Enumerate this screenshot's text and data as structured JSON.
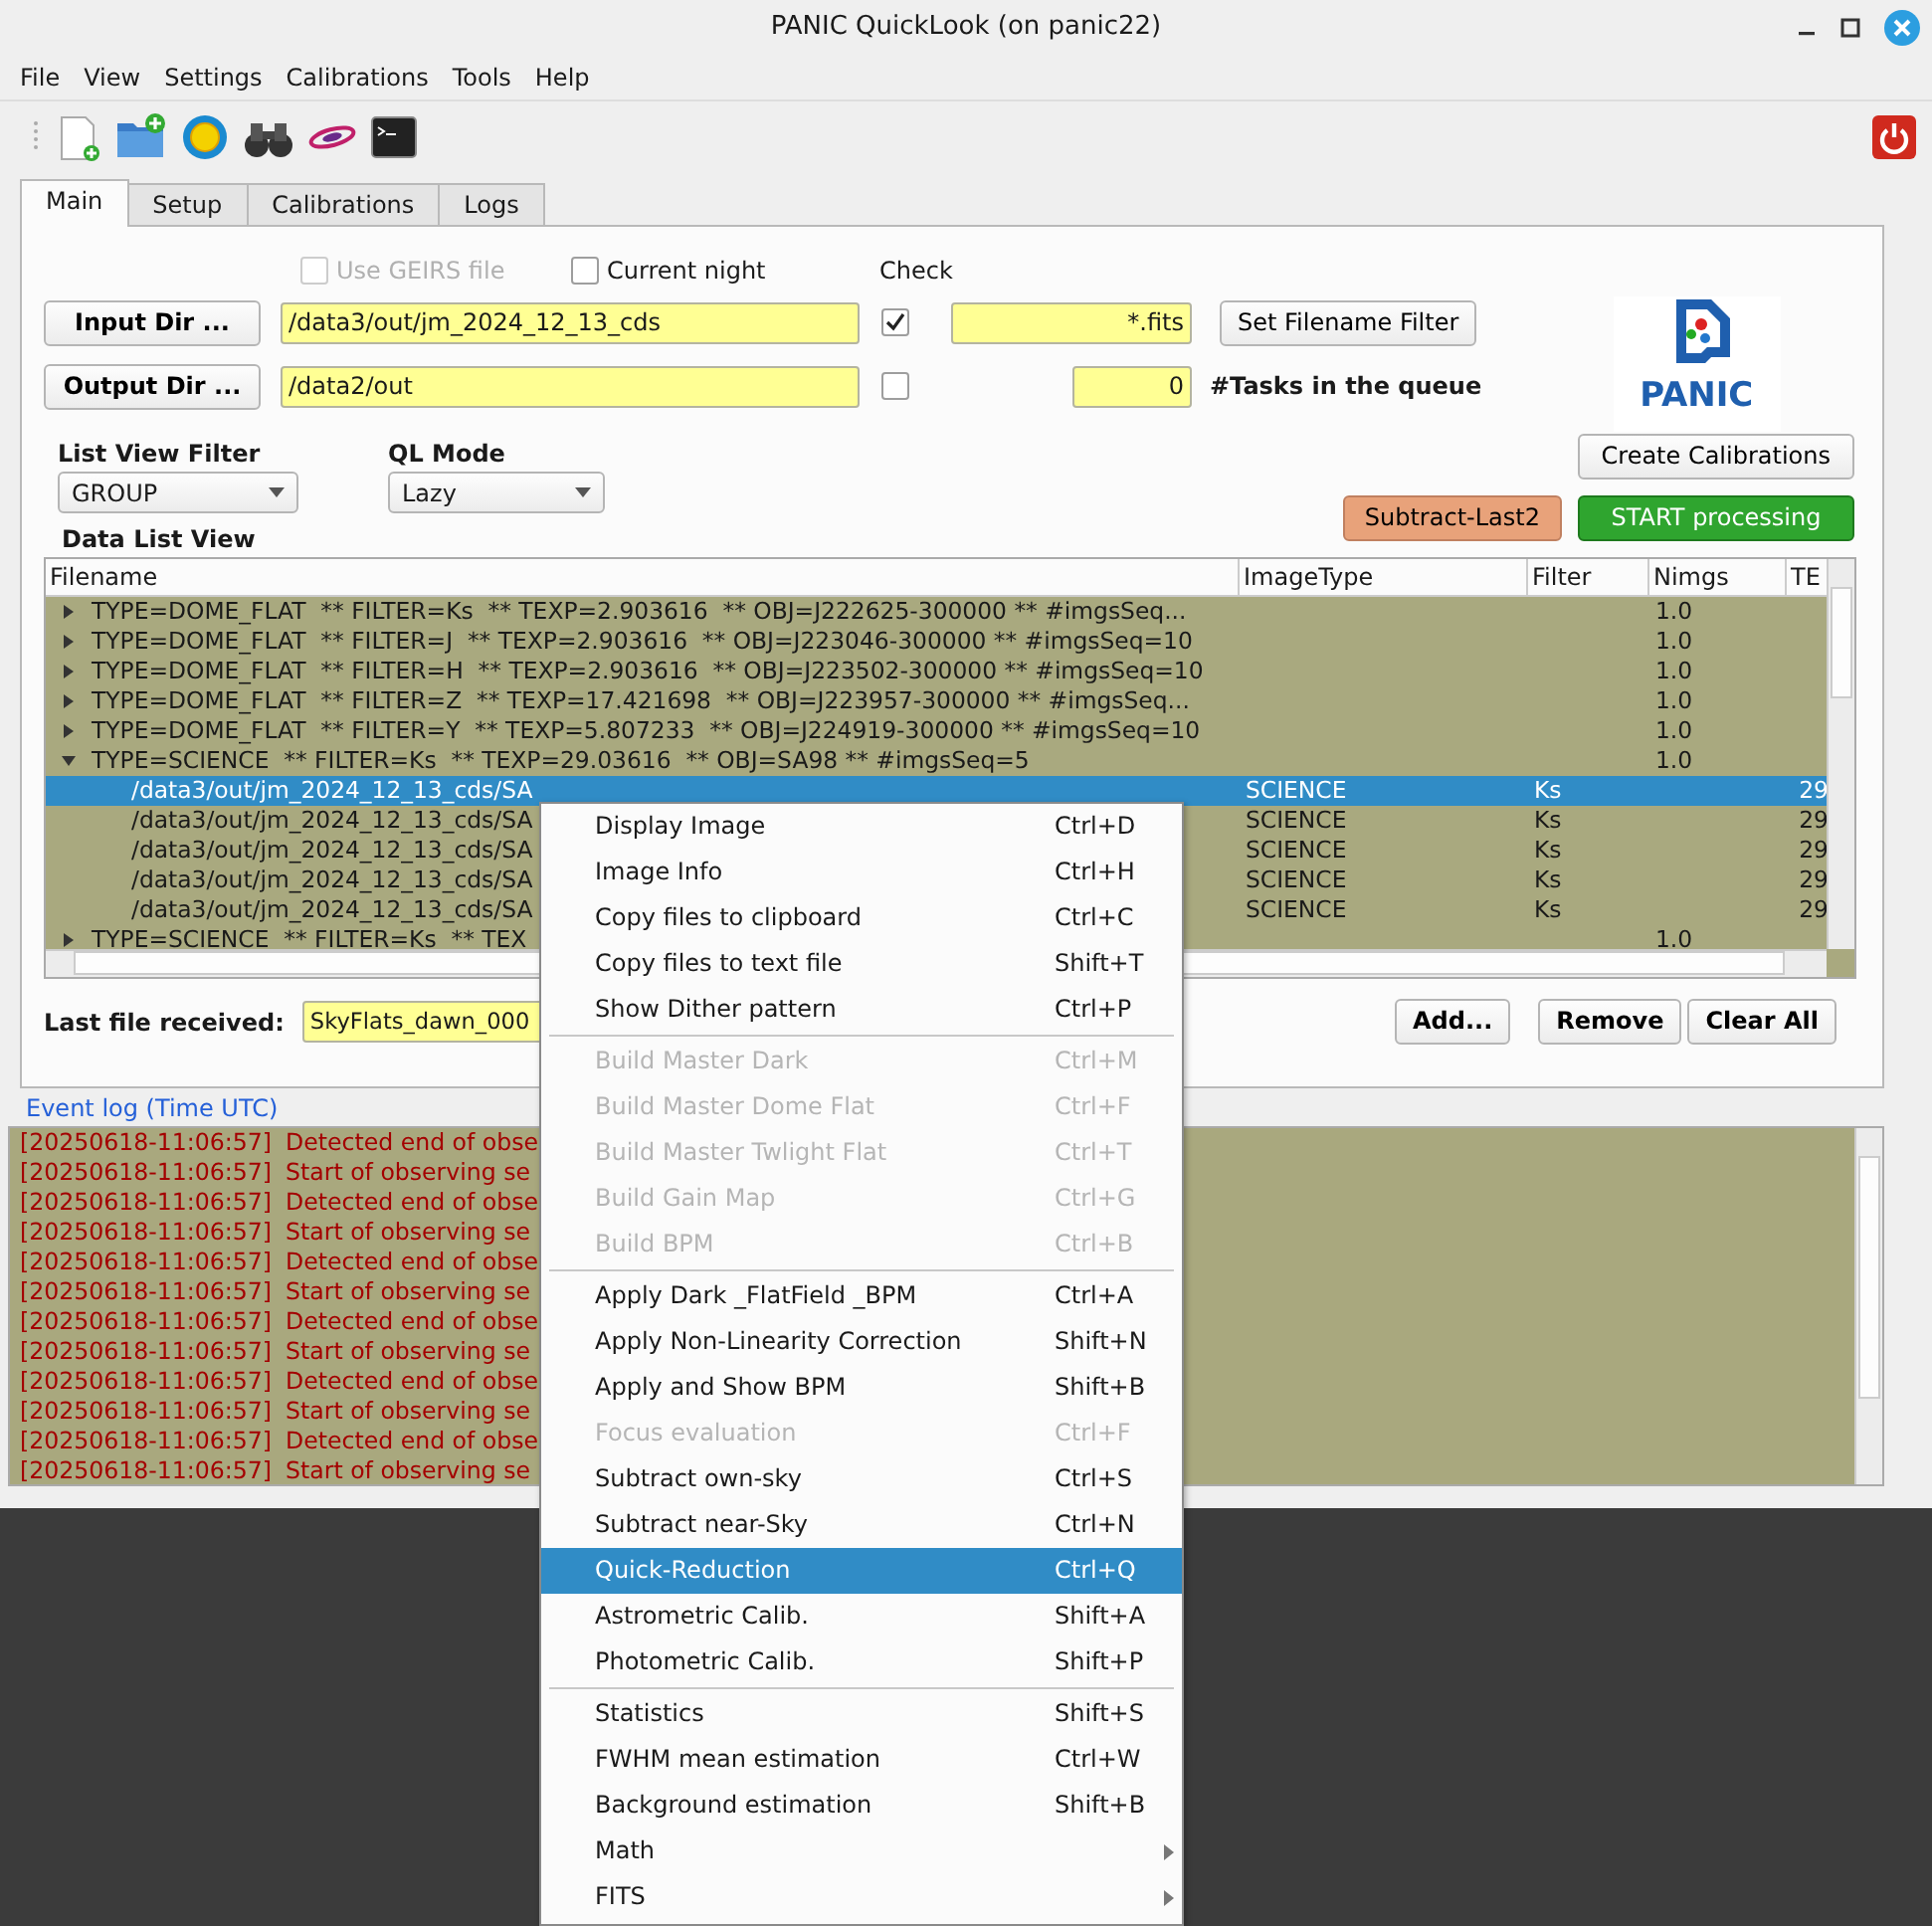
{
  "window": {
    "title": "PANIC QuickLook (on panic22)"
  },
  "menu_bar": [
    "File",
    "View",
    "Settings",
    "Calibrations",
    "Tools",
    "Help"
  ],
  "tabs": [
    {
      "label": "Main",
      "selected": true
    },
    {
      "label": "Setup",
      "selected": false
    },
    {
      "label": "Calibrations",
      "selected": false
    },
    {
      "label": "Logs",
      "selected": false
    }
  ],
  "options": [
    {
      "label": "Use GEIRS file",
      "checked": false,
      "disabled": true
    },
    {
      "label": "Current night",
      "checked": false,
      "disabled": false
    }
  ],
  "check_label": "Check",
  "input_dir": {
    "button": "Input Dir ...",
    "value": "/data3/out/jm_2024_12_13_cds",
    "checked": true
  },
  "filename_filter": {
    "value": "*.fits",
    "button": "Set Filename Filter"
  },
  "output_dir": {
    "button": "Output Dir ...",
    "value": "/data2/out",
    "checked": false
  },
  "tasks": {
    "value": "0",
    "label": "#Tasks in the queue"
  },
  "logo": {
    "text": "PANIC"
  },
  "list_view_filter": {
    "label": "List View Filter",
    "value": "GROUP"
  },
  "ql_mode": {
    "label": "QL Mode",
    "value": "Lazy"
  },
  "action_buttons": [
    {
      "label": "Create Calibrations",
      "kind": "plain"
    },
    {
      "label": "Subtract-Last2",
      "kind": "warning"
    },
    {
      "label": "START processing",
      "kind": "start"
    }
  ],
  "data_list": {
    "title": "Data List View",
    "columns": [
      "Filename",
      "ImageType",
      "Filter",
      "Nimgs",
      "TE"
    ],
    "rows": [
      {
        "text": "TYPE=DOME_FLAT  ** FILTER=Ks  ** TEXP=2.903616  ** OBJ=J222625-300000 ** #imgsSeq...",
        "nimgs": "1.0",
        "expanded": false,
        "selected": false
      },
      {
        "text": "TYPE=DOME_FLAT  ** FILTER=J  ** TEXP=2.903616  ** OBJ=J223046-300000 ** #imgsSeq=10",
        "nimgs": "1.0",
        "expanded": false,
        "selected": false
      },
      {
        "text": "TYPE=DOME_FLAT  ** FILTER=H  ** TEXP=2.903616  ** OBJ=J223502-300000 ** #imgsSeq=10",
        "nimgs": "1.0",
        "expanded": false,
        "selected": false
      },
      {
        "text": "TYPE=DOME_FLAT  ** FILTER=Z  ** TEXP=17.421698  ** OBJ=J223957-300000 ** #imgsSeq...",
        "nimgs": "1.0",
        "expanded": false,
        "selected": false
      },
      {
        "text": "TYPE=DOME_FLAT  ** FILTER=Y  ** TEXP=5.807233  ** OBJ=J224919-300000 ** #imgsSeq=10",
        "nimgs": "1.0",
        "expanded": false,
        "selected": false
      },
      {
        "text": "TYPE=SCIENCE  ** FILTER=Ks  ** TEXP=29.03616  ** OBJ=SA98 ** #imgsSeq=5",
        "nimgs": "1.0",
        "expanded": true,
        "selected": false,
        "children": [
          {
            "filename": "/data3/out/jm_2024_12_13_cds/SA",
            "image_type": "SCIENCE",
            "filter": "Ks",
            "texp": "29",
            "selected": true
          },
          {
            "filename": "/data3/out/jm_2024_12_13_cds/SA",
            "image_type": "SCIENCE",
            "filter": "Ks",
            "texp": "29",
            "selected": false
          },
          {
            "filename": "/data3/out/jm_2024_12_13_cds/SA",
            "image_type": "SCIENCE",
            "filter": "Ks",
            "texp": "29",
            "selected": false
          },
          {
            "filename": "/data3/out/jm_2024_12_13_cds/SA",
            "image_type": "SCIENCE",
            "filter": "Ks",
            "texp": "29",
            "selected": false
          },
          {
            "filename": "/data3/out/jm_2024_12_13_cds/SA",
            "image_type": "SCIENCE",
            "filter": "Ks",
            "texp": "29",
            "selected": false
          }
        ]
      },
      {
        "text": "TYPE=SCIENCE  ** FILTER=Ks  ** TEX",
        "nimgs": "1.0",
        "expanded": false,
        "selected": false
      }
    ]
  },
  "last_file": {
    "label": "Last file received:",
    "value": "SkyFlats_dawn_000"
  },
  "list_buttons": [
    "Add...",
    "Remove",
    "Clear All"
  ],
  "event_log": {
    "title": "Event log (Time UTC)",
    "lines": [
      {
        "time": "[20250618-11:06:57]",
        "message": "Detected end of obse"
      },
      {
        "time": "[20250618-11:06:57]",
        "message": "Start of observing se"
      },
      {
        "time": "[20250618-11:06:57]",
        "message": "Detected end of obse"
      },
      {
        "time": "[20250618-11:06:57]",
        "message": "Start of observing se"
      },
      {
        "time": "[20250618-11:06:57]",
        "message": "Detected end of obse"
      },
      {
        "time": "[20250618-11:06:57]",
        "message": "Start of observing se"
      },
      {
        "time": "[20250618-11:06:57]",
        "message": "Detected end of obse"
      },
      {
        "time": "[20250618-11:06:57]",
        "message": "Start of observing se"
      },
      {
        "time": "[20250618-11:06:57]",
        "message": "Detected end of obse"
      },
      {
        "time": "[20250618-11:06:57]",
        "message": "Start of observing se"
      },
      {
        "time": "[20250618-11:06:57]",
        "message": "Detected end of obse"
      },
      {
        "time": "[20250618-11:06:57]",
        "message": "Start of observing se"
      }
    ]
  },
  "context_menu": {
    "sections": [
      [
        {
          "label": "Display Image",
          "shortcut": "Ctrl+D",
          "disabled": false,
          "selected": false,
          "submenu": false
        },
        {
          "label": "Image Info",
          "shortcut": "Ctrl+H",
          "disabled": false,
          "selected": false,
          "submenu": false
        },
        {
          "label": "Copy files to clipboard",
          "shortcut": "Ctrl+C",
          "disabled": false,
          "selected": false,
          "submenu": false
        },
        {
          "label": "Copy files to text file",
          "shortcut": "Shift+T",
          "disabled": false,
          "selected": false,
          "submenu": false
        },
        {
          "label": "Show Dither pattern",
          "shortcut": "Ctrl+P",
          "disabled": false,
          "selected": false,
          "submenu": false
        }
      ],
      [
        {
          "label": "Build Master Dark",
          "shortcut": "Ctrl+M",
          "disabled": true,
          "selected": false,
          "submenu": false
        },
        {
          "label": "Build Master Dome Flat",
          "shortcut": "Ctrl+F",
          "disabled": true,
          "selected": false,
          "submenu": false
        },
        {
          "label": "Build Master Twlight Flat",
          "shortcut": "Ctrl+T",
          "disabled": true,
          "selected": false,
          "submenu": false
        },
        {
          "label": "Build Gain Map",
          "shortcut": "Ctrl+G",
          "disabled": true,
          "selected": false,
          "submenu": false
        },
        {
          "label": "Build BPM",
          "shortcut": "Ctrl+B",
          "disabled": true,
          "selected": false,
          "submenu": false
        }
      ],
      [
        {
          "label": "Apply Dark _FlatField _BPM",
          "shortcut": "Ctrl+A",
          "disabled": false,
          "selected": false,
          "submenu": false
        },
        {
          "label": "Apply Non-Linearity Correction",
          "shortcut": "Shift+N",
          "disabled": false,
          "selected": false,
          "submenu": false
        },
        {
          "label": "Apply and Show BPM",
          "shortcut": "Shift+B",
          "disabled": false,
          "selected": false,
          "submenu": false
        },
        {
          "label": "Focus evaluation",
          "shortcut": "Ctrl+F",
          "disabled": true,
          "selected": false,
          "submenu": false
        },
        {
          "label": "Subtract own-sky",
          "shortcut": "Ctrl+S",
          "disabled": false,
          "selected": false,
          "submenu": false
        },
        {
          "label": "Subtract near-Sky",
          "shortcut": "Ctrl+N",
          "disabled": false,
          "selected": false,
          "submenu": false
        },
        {
          "label": "Quick-Reduction",
          "shortcut": "Ctrl+Q",
          "disabled": false,
          "selected": true,
          "submenu": false
        },
        {
          "label": "Astrometric Calib.",
          "shortcut": "Shift+A",
          "disabled": false,
          "selected": false,
          "submenu": false
        },
        {
          "label": "Photometric Calib.",
          "shortcut": "Shift+P",
          "disabled": false,
          "selected": false,
          "submenu": false
        }
      ],
      [
        {
          "label": "Statistics",
          "shortcut": "Shift+S",
          "disabled": false,
          "selected": false,
          "submenu": false
        },
        {
          "label": "FWHM mean estimation",
          "shortcut": "Ctrl+W",
          "disabled": false,
          "selected": false,
          "submenu": false
        },
        {
          "label": "Background estimation",
          "shortcut": "Shift+B",
          "disabled": false,
          "selected": false,
          "submenu": false
        },
        {
          "label": "Math",
          "disabled": false,
          "selected": false,
          "submenu": true
        },
        {
          "label": "FITS",
          "disabled": false,
          "selected": false,
          "submenu": true
        }
      ]
    ]
  }
}
